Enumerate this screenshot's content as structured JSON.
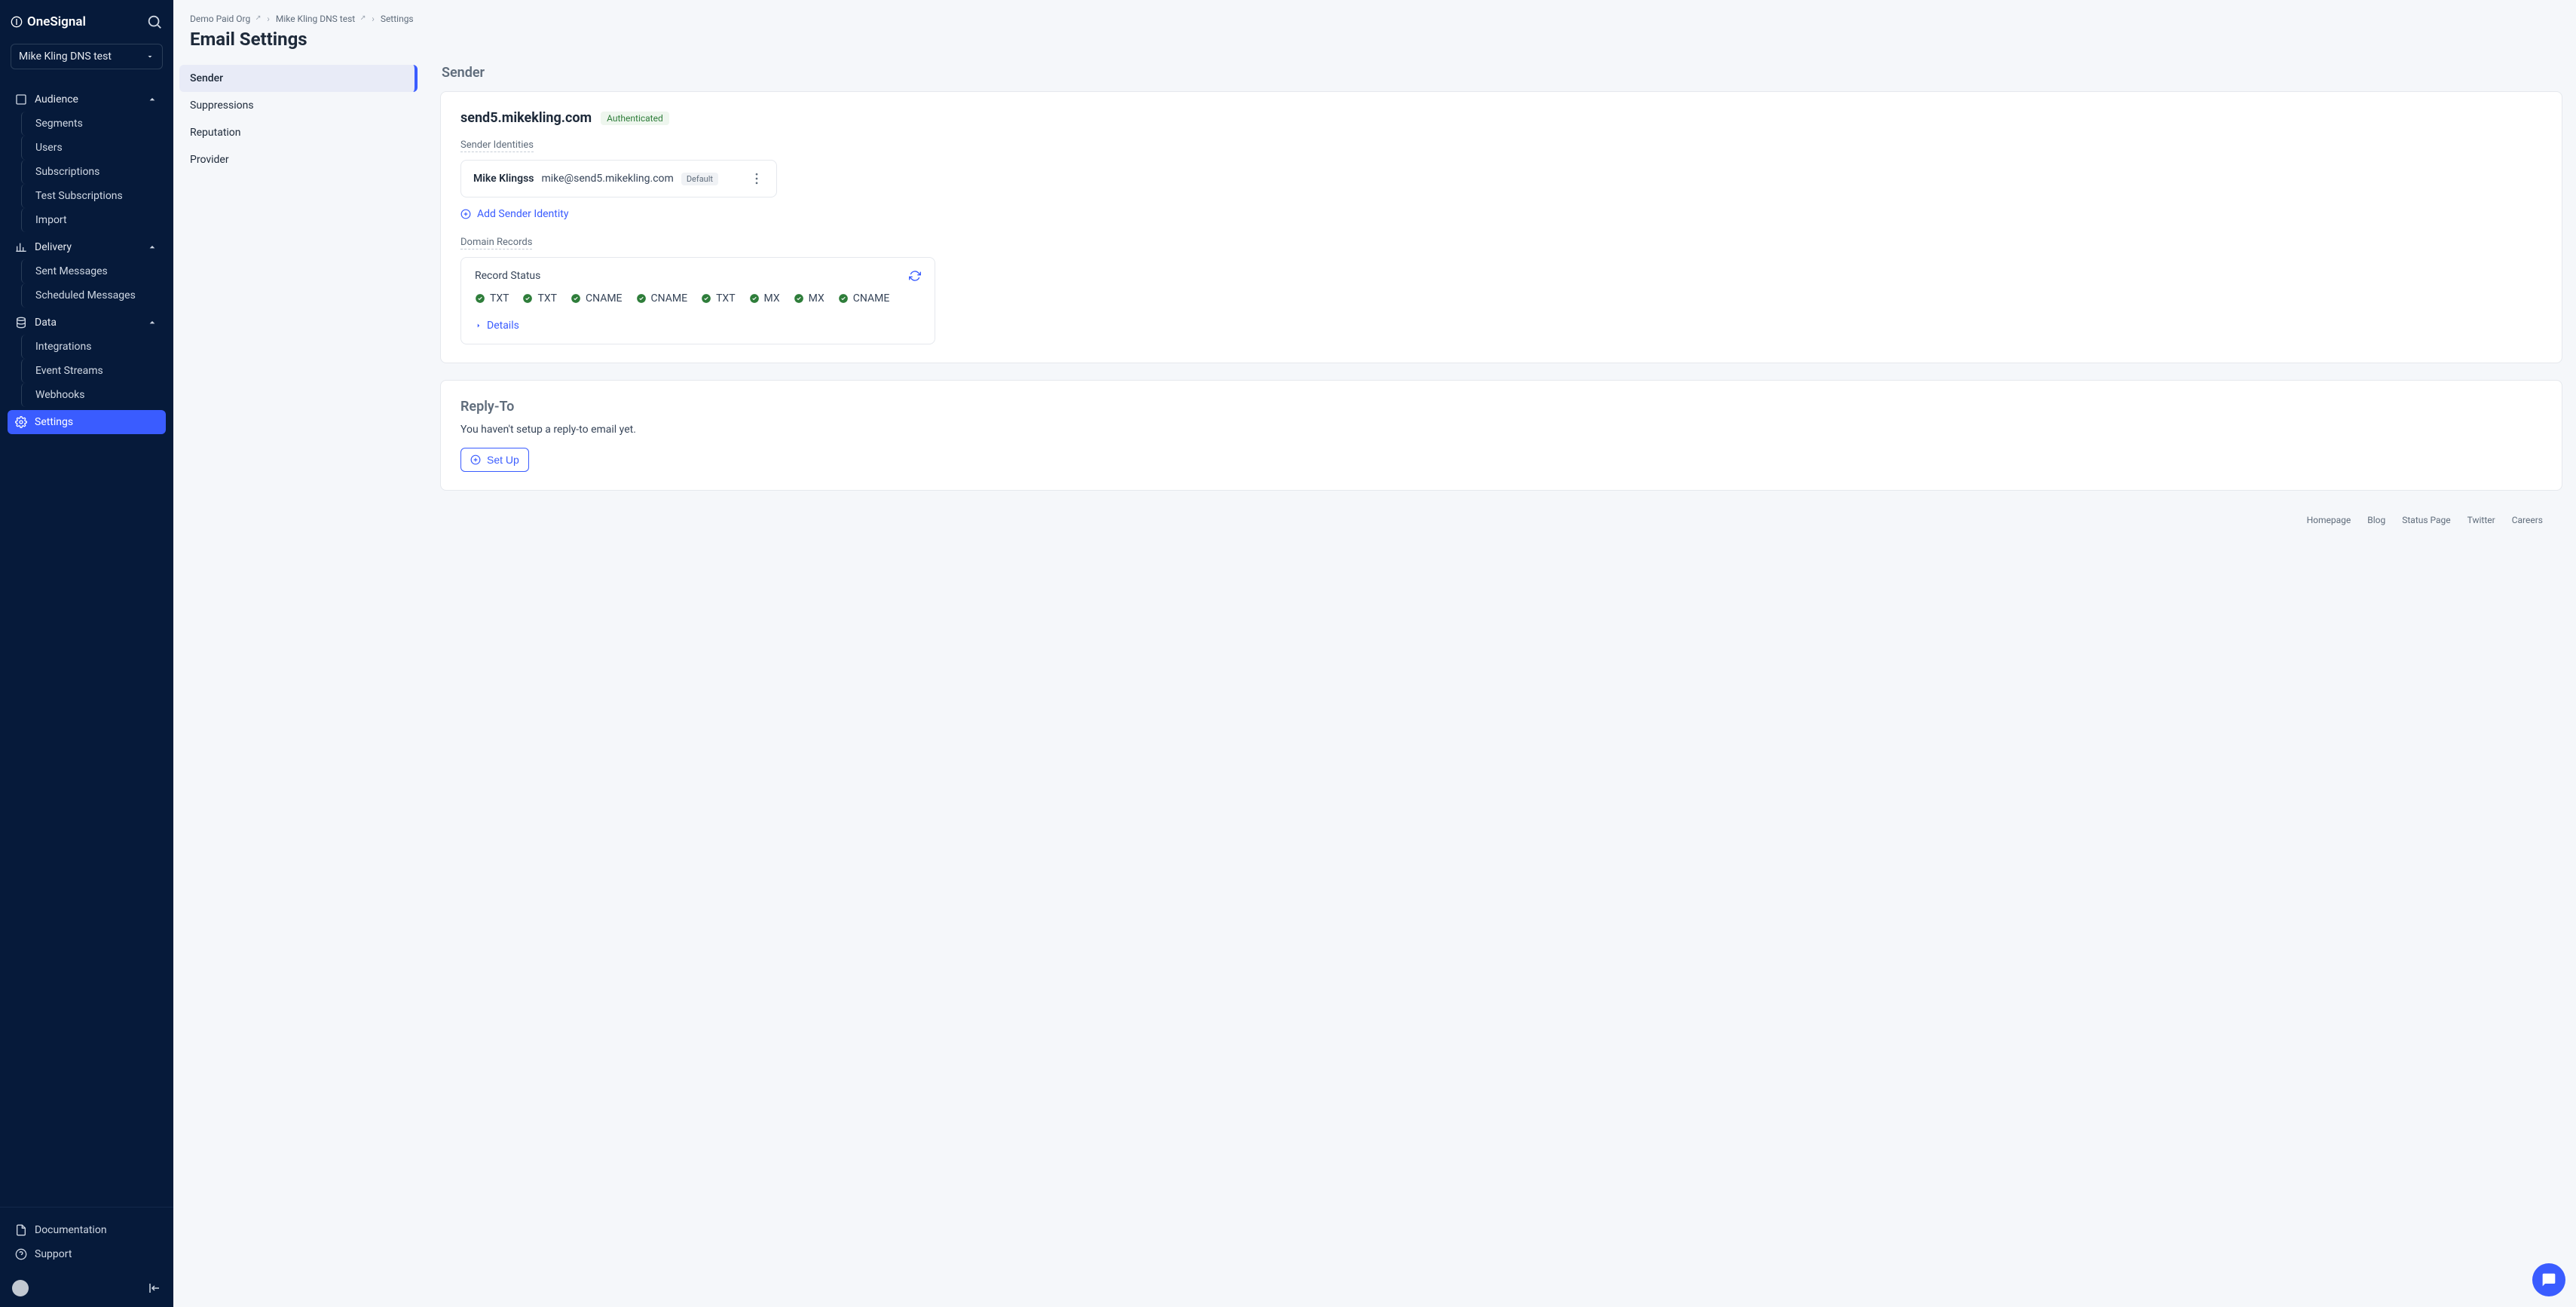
{
  "brand": "OneSignal",
  "app_select": "Mike Kling DNS test",
  "sidebar": {
    "groups": [
      {
        "label": "Audience",
        "items": [
          "Segments",
          "Users",
          "Subscriptions",
          "Test Subscriptions",
          "Import"
        ]
      },
      {
        "label": "Delivery",
        "items": [
          "Sent Messages",
          "Scheduled Messages"
        ]
      },
      {
        "label": "Data",
        "items": [
          "Integrations",
          "Event Streams",
          "Webhooks"
        ]
      }
    ],
    "settings": "Settings",
    "docs": "Documentation",
    "support": "Support"
  },
  "breadcrumbs": [
    "Demo Paid Org",
    "Mike Kling DNS test",
    "Settings"
  ],
  "page_title": "Email Settings",
  "tabs": [
    "Sender",
    "Suppressions",
    "Reputation",
    "Provider"
  ],
  "sender": {
    "section_title": "Sender",
    "domain": "send5.mikekling.com",
    "auth_badge": "Authenticated",
    "identities_label": "Sender Identities",
    "identity": {
      "name": "Mike Klingss",
      "email": "mike@send5.mikekling.com",
      "badge": "Default"
    },
    "add_identity": "Add Sender Identity",
    "domain_records_label": "Domain Records",
    "record_status": "Record Status",
    "records": [
      "TXT",
      "TXT",
      "CNAME",
      "CNAME",
      "TXT",
      "MX",
      "MX",
      "CNAME"
    ],
    "details": "Details"
  },
  "reply_to": {
    "title": "Reply-To",
    "desc": "You haven't setup a reply-to email yet.",
    "btn": "Set Up"
  },
  "footer": [
    "Homepage",
    "Blog",
    "Status Page",
    "Twitter",
    "Careers"
  ]
}
